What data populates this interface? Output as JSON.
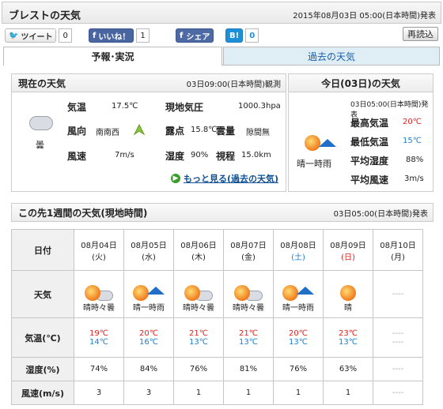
{
  "header": {
    "title": "ブレストの天気",
    "date": "2015年08月03日 05:00(日本時間)発表"
  },
  "social": {
    "tweet_label": "ツイート",
    "tweet_count": "0",
    "like_label": "いいね！",
    "like_count": "1",
    "share_label": "シェア",
    "hatena_label": "B!",
    "hatena_count": "0",
    "reload_label": "再読込"
  },
  "tabs": {
    "active": "予報･実況",
    "other": "過去の天気"
  },
  "current": {
    "heading": "現在の天気",
    "observed": "03日09:00(日本時間)観測",
    "weather": "曇",
    "rows": {
      "temp_label": "気温",
      "temp_value": "17.5℃",
      "pressure_label": "現地気圧",
      "pressure_value": "1000.3hpa",
      "wind_dir_label": "風向",
      "wind_dir_value": "南南西",
      "dew_label": "露点",
      "dew_value": "15.8℃",
      "cloud_label": "雲量",
      "cloud_value": "隙間無",
      "wind_speed_label": "風速",
      "wind_speed_value": "7m/s",
      "humidity_label": "湿度",
      "humidity_value": "90%",
      "visibility_label": "視程",
      "visibility_value": "15.0km"
    },
    "more_link": "もっと見る(過去の天気)"
  },
  "today": {
    "heading": "今日(03日)の天気",
    "issued": "03日05:00(日本時間)発表",
    "weather": "晴一時雨",
    "max_label": "最高気温",
    "max_value": "20℃",
    "min_label": "最低気温",
    "min_value": "15℃",
    "humidity_label": "平均湿度",
    "humidity_value": "88%",
    "wind_label": "平均風速",
    "wind_value": "3m/s"
  },
  "week": {
    "heading": "この先1週間の天気(現地時間)",
    "issued": "03日05:00(日本時間)発表",
    "row_labels": {
      "date": "日付",
      "weather": "天気",
      "temp": "気温(℃)",
      "humidity": "湿度(%)",
      "wind": "風速(m/s)"
    },
    "days": [
      {
        "date": "08月04日",
        "dow": "(火)",
        "weather": "晴時々曇",
        "icon": "sun-cloud",
        "high": "19℃",
        "low": "14℃",
        "humidity": "74%",
        "wind": "3"
      },
      {
        "date": "08月05日",
        "dow": "(水)",
        "weather": "晴一時雨",
        "icon": "sun-umbrella",
        "high": "20℃",
        "low": "16℃",
        "humidity": "84%",
        "wind": "3"
      },
      {
        "date": "08月06日",
        "dow": "(木)",
        "weather": "晴時々曇",
        "icon": "sun-cloud",
        "high": "21℃",
        "low": "13℃",
        "humidity": "76%",
        "wind": "1"
      },
      {
        "date": "08月07日",
        "dow": "(金)",
        "weather": "晴時々曇",
        "icon": "sun-cloud",
        "high": "21℃",
        "low": "13℃",
        "humidity": "81%",
        "wind": "1"
      },
      {
        "date": "08月08日",
        "dow": "(土)",
        "weather": "晴一時雨",
        "icon": "sun-umbrella",
        "high": "20℃",
        "low": "13℃",
        "humidity": "76%",
        "wind": "1"
      },
      {
        "date": "08月09日",
        "dow": "(日)",
        "weather": "晴",
        "icon": "sun",
        "high": "23℃",
        "low": "13℃",
        "humidity": "63%",
        "wind": "1"
      },
      {
        "date": "08月10日",
        "dow": "(月)",
        "weather": "----",
        "icon": "",
        "high": "----",
        "low": "----",
        "humidity": "----",
        "wind": "----"
      }
    ]
  },
  "colors": {
    "saturday": "#1b7fd0",
    "sunday": "#e0201d",
    "high": "#e0201d",
    "low": "#1b7fd0"
  }
}
